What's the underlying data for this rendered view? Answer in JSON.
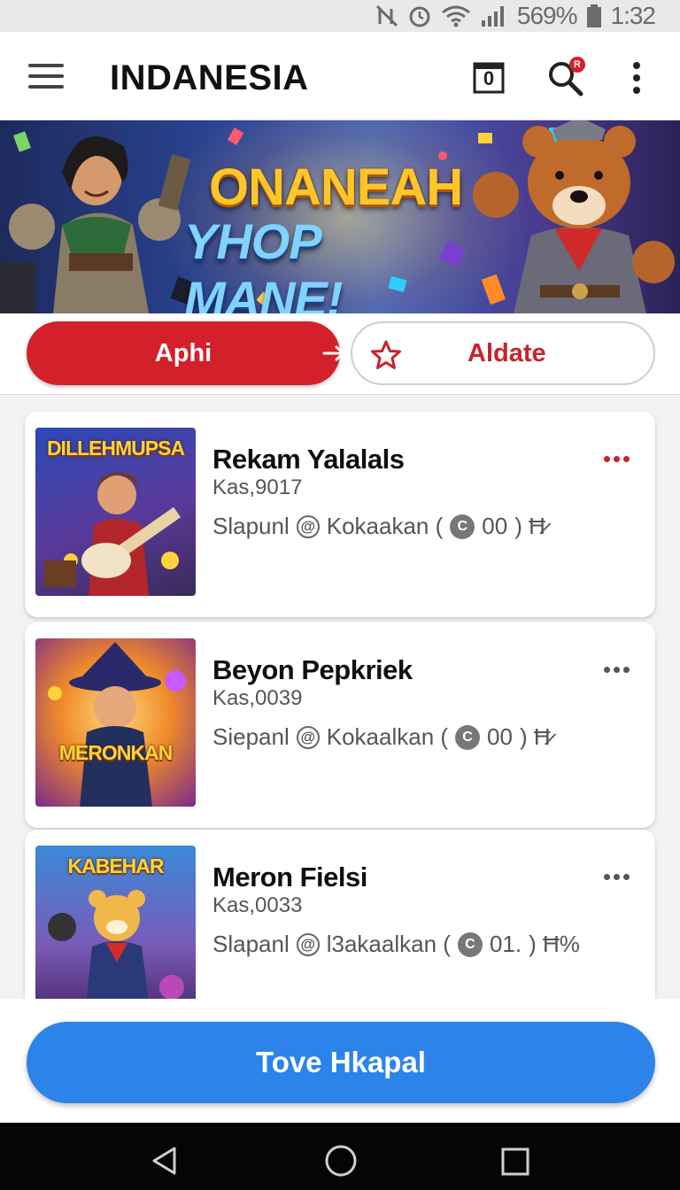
{
  "status_bar": {
    "battery_text": "569%",
    "clock": "1:32",
    "icons": [
      "mute-icon",
      "alarm-icon",
      "wifi-icon",
      "signal-icon",
      "battery-icon"
    ]
  },
  "app_bar": {
    "title": "INDANESIA",
    "cart_count": "0",
    "search_badge": "R"
  },
  "hero": {
    "title_line_1": "ONANEAH",
    "title_line_2": "YHOP MANE!"
  },
  "actions": {
    "primary_label": "Aphi",
    "secondary_label": "Aldate"
  },
  "items": [
    {
      "thumb_title": "DILLEHMUPSA",
      "title": "Rekam Yalalals",
      "subtitle": "Kas,9017",
      "meta_left": "Slapunl",
      "meta_mid": "Kokaakan (",
      "meta_coin": "00",
      "meta_tail": ") Ħ̷",
      "more_color": "#c8232b"
    },
    {
      "thumb_title": "MERONKAN",
      "title": "Beyon Pepkriek",
      "subtitle": "Kas,0039",
      "meta_left": "Siepanl",
      "meta_mid": "Kokaalkan (",
      "meta_coin": "00",
      "meta_tail": ") Ħ̷",
      "more_color": "#555555"
    },
    {
      "thumb_title": "KABEHAR",
      "title": "Meron Fielsi",
      "subtitle": "Kas,0033",
      "meta_left": "Slapanl",
      "meta_mid": "l3akaalkan (",
      "meta_coin": "01.",
      "meta_tail": ") Ħ%",
      "more_color": "#555555"
    }
  ],
  "cta": {
    "label": "Tove Hkapal"
  },
  "colors": {
    "brand_red": "#d3202a",
    "cta_blue": "#2c83ea"
  }
}
